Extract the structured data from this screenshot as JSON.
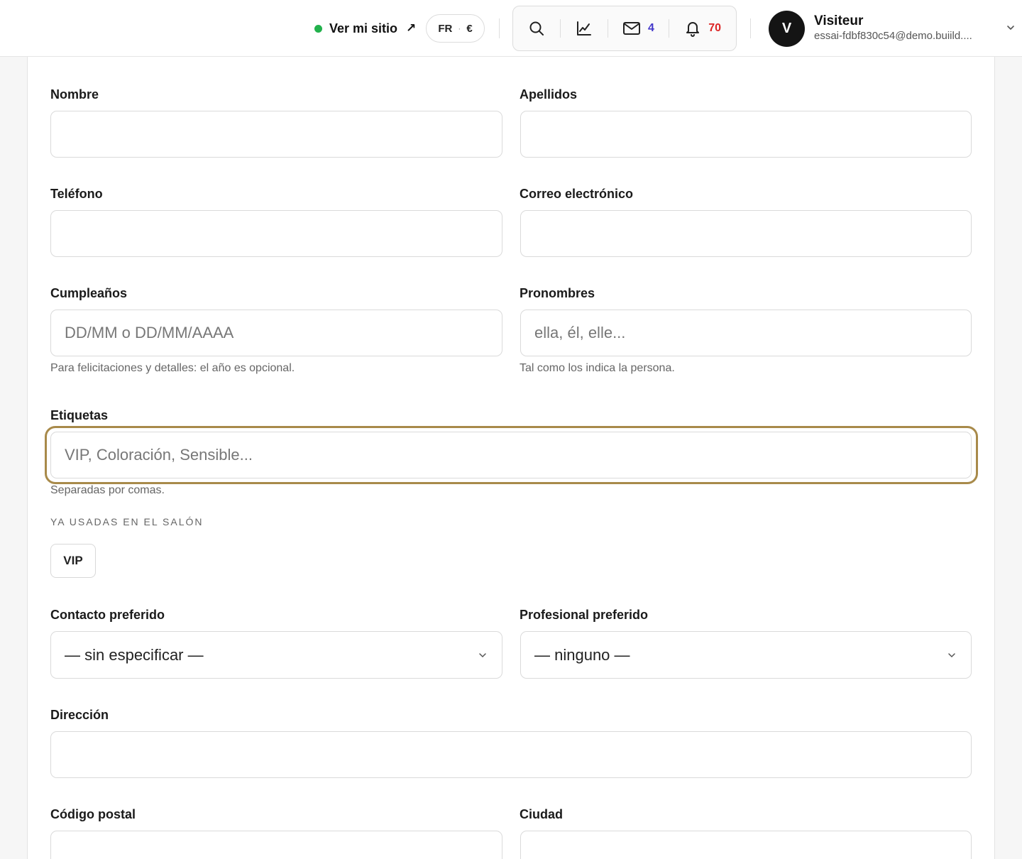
{
  "header": {
    "site_link": "Ver mi sitio",
    "site_link_arrow": "↗",
    "locale": {
      "language": "FR",
      "separator": "·",
      "currency": "€"
    },
    "icons": {
      "search": "search-icon",
      "stats": "line-chart-icon",
      "mail": "mail-icon",
      "bell": "bell-icon"
    },
    "mail_count": "4",
    "notification_count": "70",
    "user": {
      "initial": "V",
      "name": "Visiteur",
      "email": "essai-fdbf830c54@demo.buiild...."
    },
    "colors": {
      "status_dot": "#22b14c",
      "mail_count": "#4338ca",
      "bell_count": "#dc2626"
    }
  },
  "form": {
    "first_name": {
      "label": "Nombre",
      "value": "",
      "placeholder": ""
    },
    "last_name": {
      "label": "Apellidos",
      "value": "",
      "placeholder": ""
    },
    "phone": {
      "label": "Teléfono",
      "value": "",
      "placeholder": ""
    },
    "email": {
      "label": "Correo electrónico",
      "value": "",
      "placeholder": ""
    },
    "birthday": {
      "label": "Cumpleaños",
      "placeholder": "DD/MM o DD/MM/AAAA",
      "help": "Para felicitaciones y detalles: el año es opcional."
    },
    "pronouns": {
      "label": "Pronombres",
      "placeholder": "ella, él, elle...",
      "help": "Tal como los indica la persona."
    },
    "tags": {
      "label": "Etiquetas",
      "placeholder": "VIP, Coloración, Sensible...",
      "help": "Separadas por comas.",
      "used_caption": "YA USADAS EN EL SALÓN",
      "used": [
        "VIP"
      ],
      "focus_color": "#a88a4a"
    },
    "preferred_contact": {
      "label": "Contacto preferido",
      "selected": "— sin especificar —"
    },
    "preferred_staff": {
      "label": "Profesional preferido",
      "selected": "— ninguno —"
    },
    "address": {
      "label": "Dirección",
      "value": "",
      "placeholder": ""
    },
    "postal_code": {
      "label": "Código postal",
      "value": "",
      "placeholder": ""
    },
    "city": {
      "label": "Ciudad",
      "value": "",
      "placeholder": ""
    }
  }
}
